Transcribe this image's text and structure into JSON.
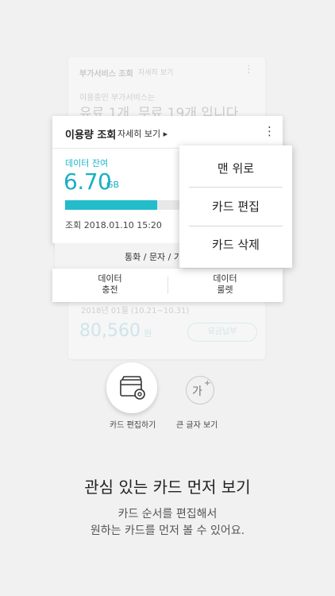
{
  "background_card": {
    "title": "부가서비스 조회",
    "detail_link": "자세히 보기",
    "subtitle": "이용중인 부가서비스는",
    "summary": "유료 1개, 무료 19개 입니다",
    "period": "2018년 01월 (10.21~10.31)",
    "amount": "80,560",
    "currency": "원",
    "pay_button": "요금납부"
  },
  "usage_card": {
    "title": "이용량 조회",
    "detail_link": "자세히 보기 ▸",
    "data_label": "데이터 잔여",
    "data_value": "6.70",
    "data_unit": "GB",
    "data_progress_pct": 45,
    "timestamp": "조회  2018.01.10  15:20",
    "tabs_label": "통화 / 문자 / 기타",
    "btn_data_charge_1": "데이터",
    "btn_data_charge_2": "충전",
    "btn_data_roulette_1": "데이터",
    "btn_data_roulette_2": "룰렛"
  },
  "popup_menu": {
    "items": [
      "맨 위로",
      "카드 편집",
      "카드 삭제"
    ]
  },
  "actions": {
    "edit_card_label": "카드 편집하기",
    "large_text_label": "큰 글자 보기",
    "large_text_glyph": "가",
    "large_text_plus": "+"
  },
  "promo": {
    "headline": "관심 있는 카드 먼저 보기",
    "line1": "카드 순서를 편집해서",
    "line2": "원하는 카드를 먼저 볼 수 있어요."
  },
  "colors": {
    "accent": "#1ab7c7",
    "background": "#f1f1f1"
  }
}
